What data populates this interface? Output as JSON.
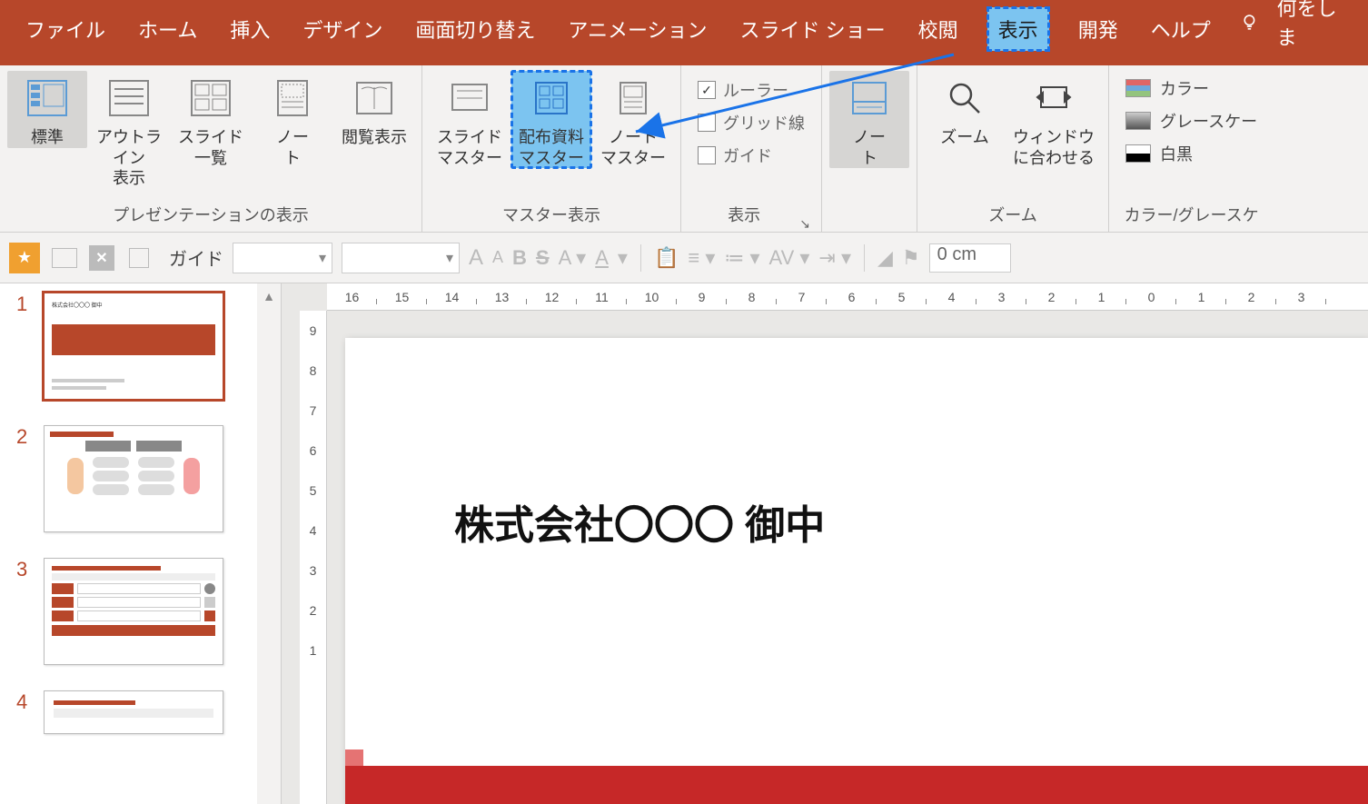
{
  "menubar": {
    "tabs": [
      "ファイル",
      "ホーム",
      "挿入",
      "デザイン",
      "画面切り替え",
      "アニメーション",
      "スライド ショー",
      "校閲",
      "表示",
      "開発",
      "ヘルプ"
    ],
    "highlighted": "表示",
    "tellme": "何をしま"
  },
  "ribbon": {
    "groups": {
      "presentation_views": {
        "label": "プレゼンテーションの表示",
        "items": [
          {
            "key": "normal",
            "label": "標準",
            "selected": true
          },
          {
            "key": "outline",
            "label": "アウトライン\n表示"
          },
          {
            "key": "sorter",
            "label": "スライド\n一覧"
          },
          {
            "key": "notes",
            "label": "ノー\nト"
          },
          {
            "key": "reading",
            "label": "閲覧表示"
          }
        ]
      },
      "master_views": {
        "label": "マスター表示",
        "items": [
          {
            "key": "slide-master",
            "label": "スライド\nマスター"
          },
          {
            "key": "handout-master",
            "label": "配布資料\nマスター",
            "highlighted": true
          },
          {
            "key": "notes-master",
            "label": "ノート\nマスター"
          }
        ]
      },
      "show_group": {
        "label": "表示",
        "checks": [
          {
            "key": "ruler",
            "label": "ルーラー",
            "checked": true
          },
          {
            "key": "gridlines",
            "label": "グリッド線",
            "checked": false
          },
          {
            "key": "guides",
            "label": "ガイド",
            "checked": false
          }
        ]
      },
      "notes_btn": {
        "label": "ノー\nト"
      },
      "zoom_group": {
        "label": "ズーム",
        "items": [
          {
            "key": "zoom",
            "label": "ズーム"
          },
          {
            "key": "fit",
            "label": "ウィンドウ\nに合わせる"
          }
        ]
      },
      "color_group": {
        "label": "カラー/グレースケ",
        "items": [
          {
            "key": "color",
            "label": "カラー",
            "swatch": "#e06666,#6fa8dc,#93c47d"
          },
          {
            "key": "gray",
            "label": "グレースケー",
            "swatch": "#888"
          },
          {
            "key": "bw",
            "label": "白黒",
            "swatch": "#000"
          }
        ]
      }
    }
  },
  "quickbar": {
    "guide_label": "ガイド",
    "measure_value": "0 cm",
    "font_buttons": [
      "A",
      "A",
      "B",
      "S",
      "A",
      "A"
    ]
  },
  "hruler_ticks": [
    "16",
    "15",
    "14",
    "13",
    "12",
    "11",
    "10",
    "9",
    "8",
    "7",
    "6",
    "5",
    "4",
    "3",
    "2",
    "1",
    "0",
    "1",
    "2",
    "3"
  ],
  "vruler_ticks": [
    "9",
    "8",
    "7",
    "6",
    "5",
    "4",
    "3",
    "2",
    "1"
  ],
  "thumbs": [
    1,
    2,
    3,
    4
  ],
  "slide": {
    "title": "株式会社〇〇〇 御中"
  }
}
